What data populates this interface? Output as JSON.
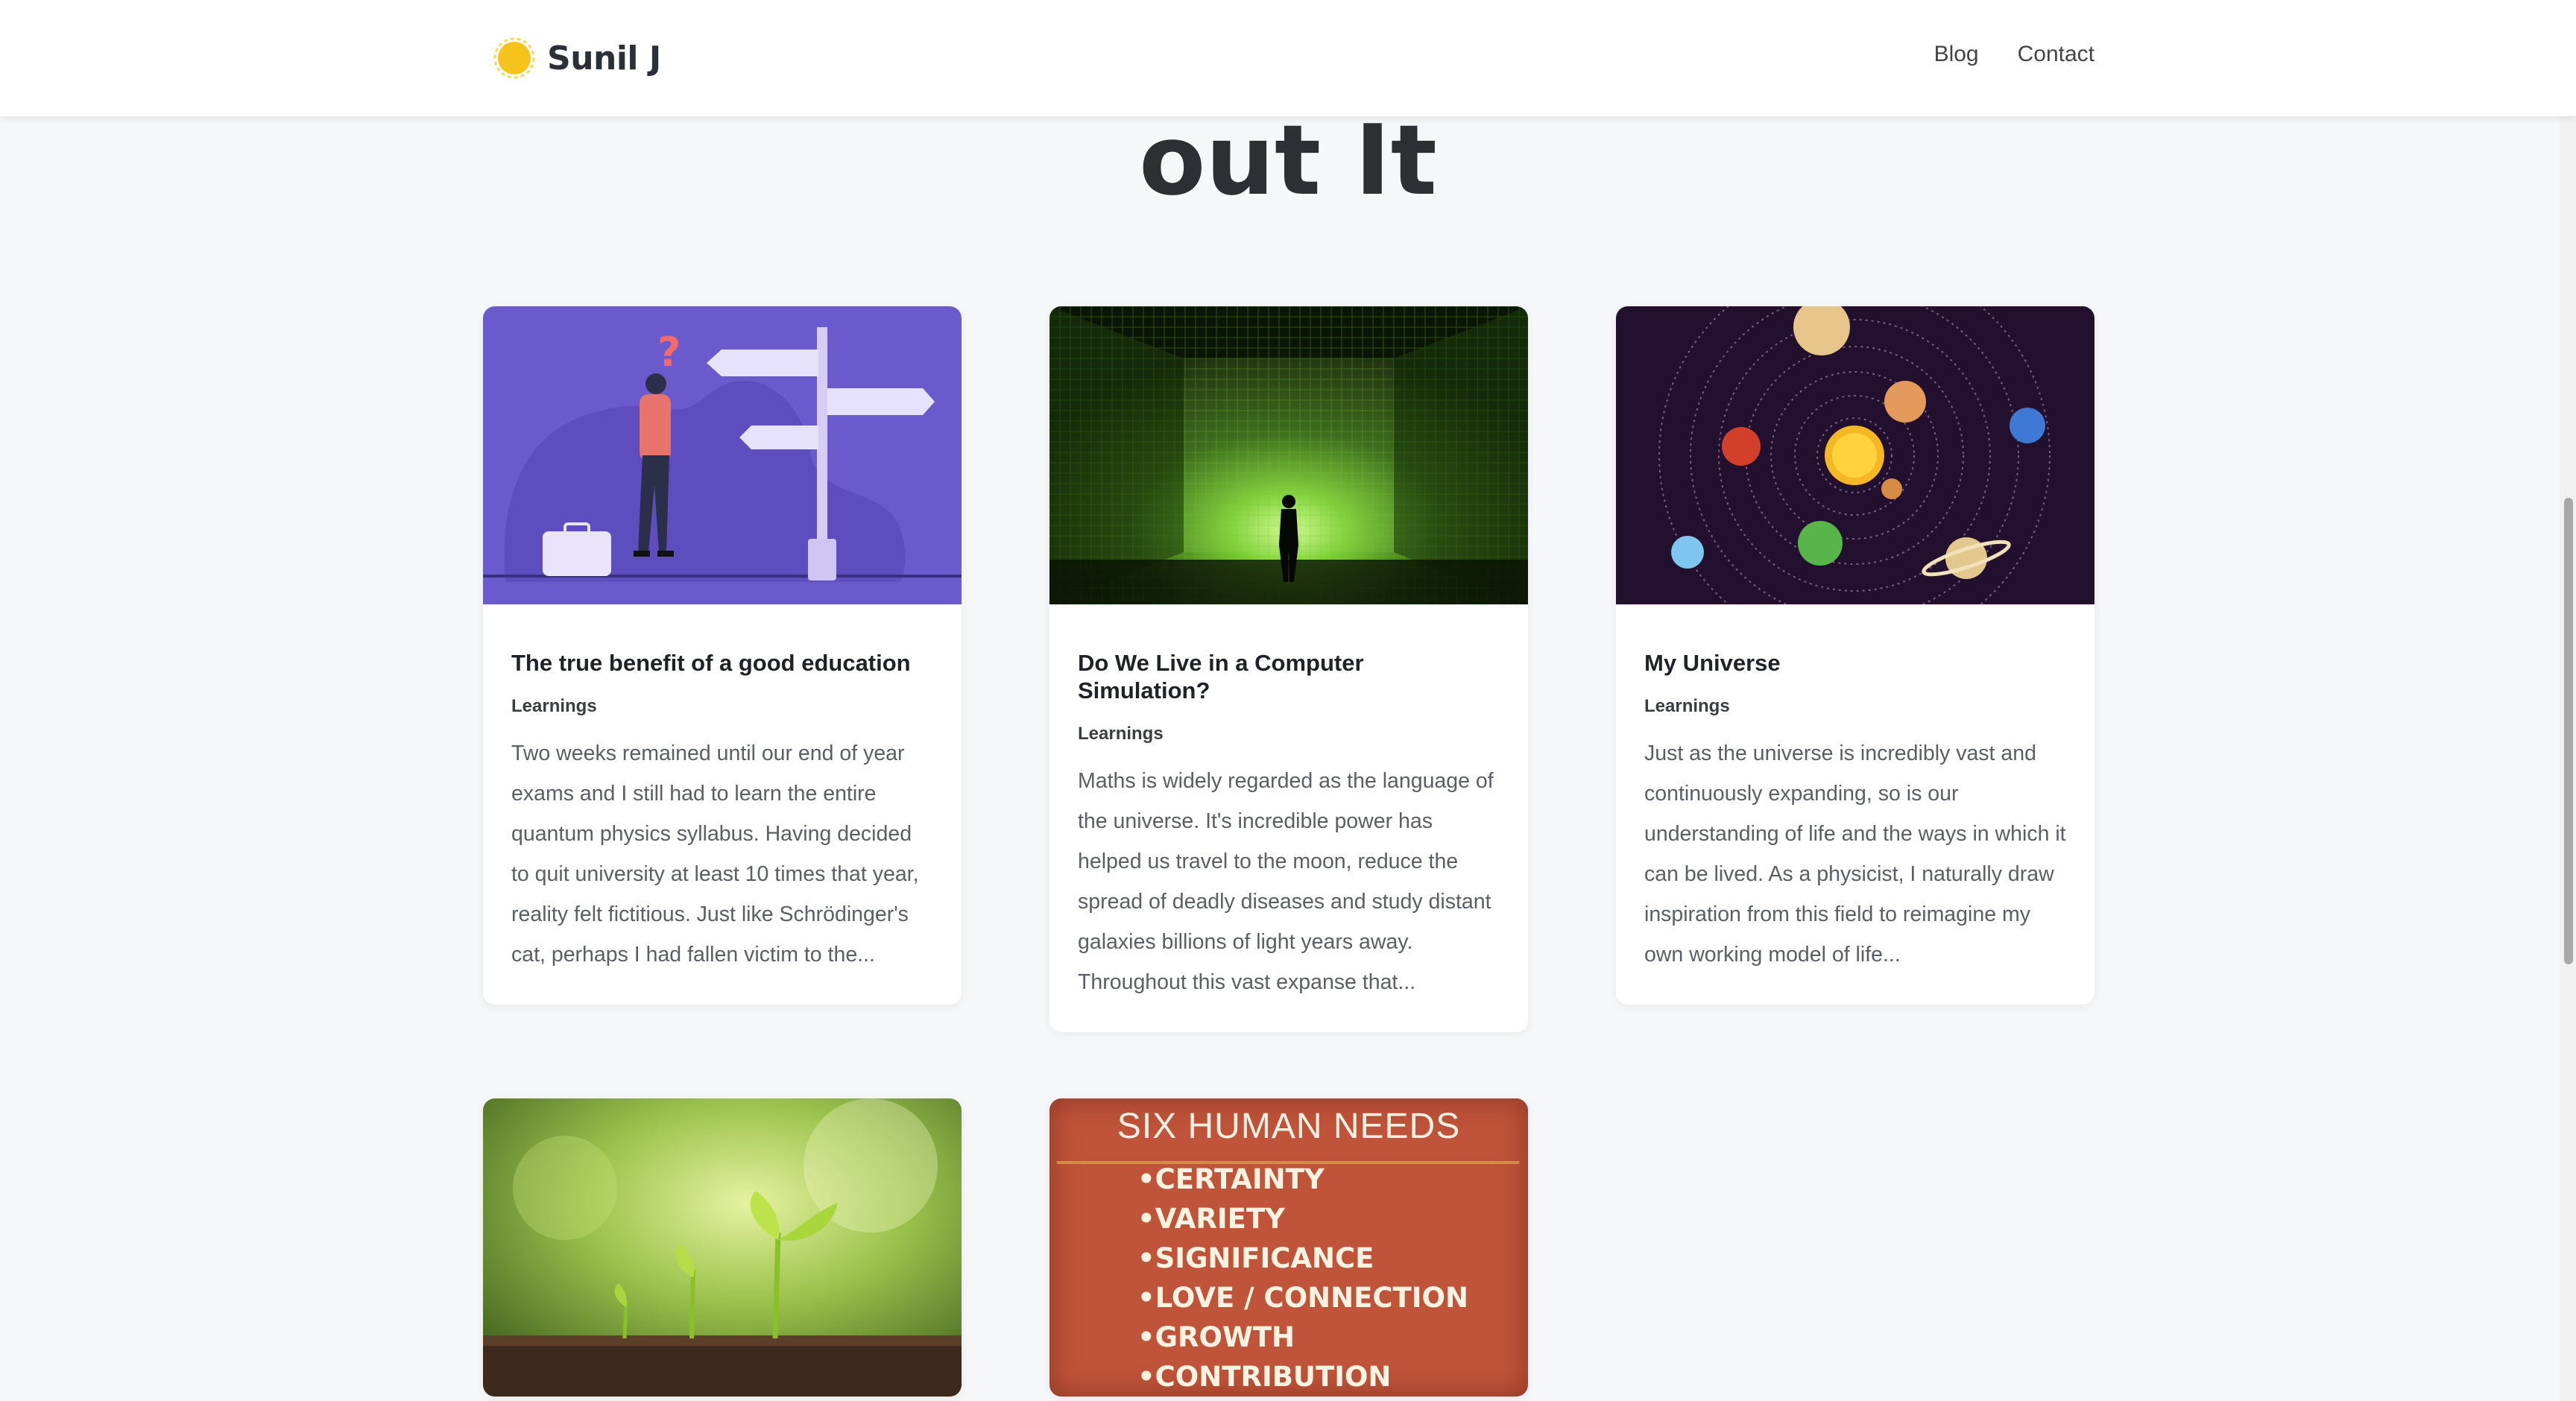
{
  "header": {
    "logo_text": "Sunil J",
    "nav": [
      "Blog",
      "Contact"
    ]
  },
  "hero": {
    "title_fragment": "out It"
  },
  "posts": [
    {
      "title": "The true benefit of a good education",
      "category": "Learnings",
      "excerpt": "Two weeks remained until our end of year exams and I still had to learn the entire quantum physics syllabus. Having decided to quit university at least 10 times that year, reality felt fictitious. Just like Schrödinger's cat, perhaps I had fallen victim to the..."
    },
    {
      "title": "Do We Live in a Computer Simulation?",
      "category": "Learnings",
      "excerpt": "Maths is widely regarded as the language of the universe. It's incredible power has helped us travel to the moon, reduce the spread of deadly diseases and study distant galaxies billions of light years away. Throughout this vast expanse that..."
    },
    {
      "title": "My Universe",
      "category": "Learnings",
      "excerpt": "Just as the universe is incredibly vast and continuously expanding, so is our understanding of life and the ways in which it can be lived. As a physicist, I naturally draw inspiration from this field to reimagine my own working model of life..."
    }
  ],
  "needs_image": {
    "heading": "SIX HUMAN NEEDS",
    "items": [
      "•CERTAINTY",
      "•VARIETY",
      "•SIGNIFICANCE",
      "•LOVE / CONNECTION",
      "•GROWTH",
      "•CONTRIBUTION"
    ]
  },
  "colors": {
    "accent_purple": "#6b5acd",
    "sun_yellow": "#f6c21c"
  },
  "icons": {
    "logo": "sun-icon"
  }
}
